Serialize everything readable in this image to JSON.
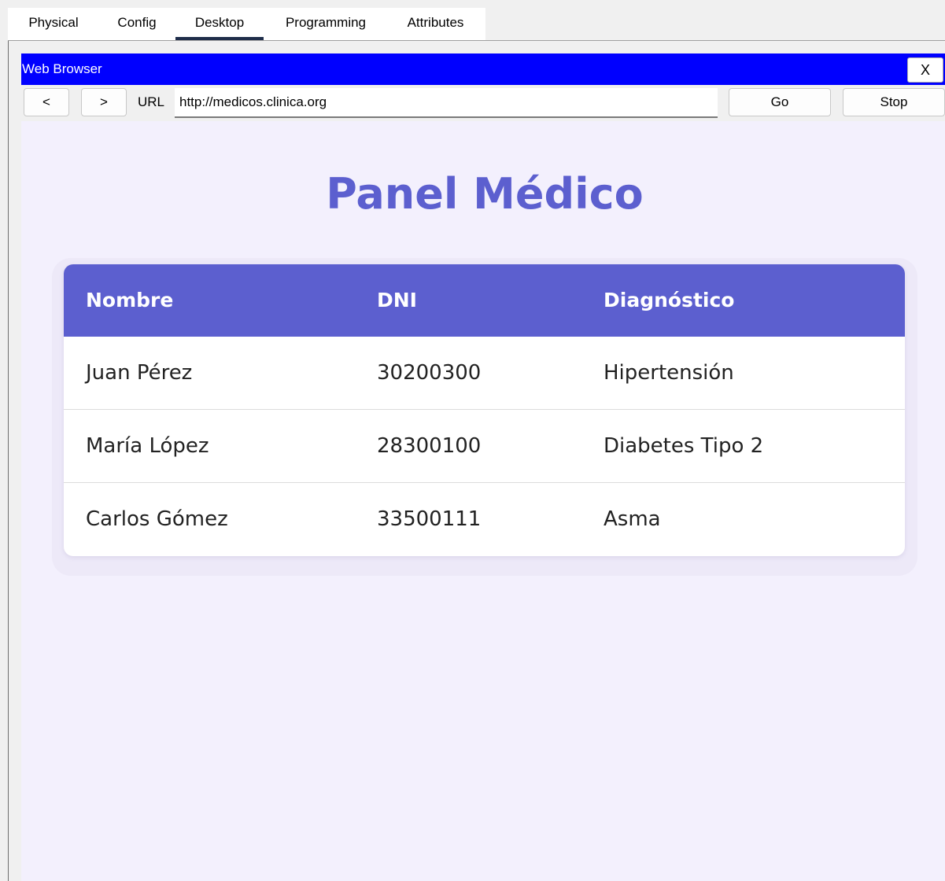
{
  "tabs": [
    {
      "label": "Physical"
    },
    {
      "label": "Config"
    },
    {
      "label": "Desktop"
    },
    {
      "label": "Programming"
    },
    {
      "label": "Attributes"
    }
  ],
  "active_tab": "Desktop",
  "window": {
    "title": "Web Browser",
    "close_label": "X"
  },
  "toolbar": {
    "back_label": "<",
    "forward_label": ">",
    "url_label": "URL",
    "url_value": "http://medicos.clinica.org",
    "go_label": "Go",
    "stop_label": "Stop"
  },
  "page": {
    "title": "Panel Médico",
    "accent_color": "#5c5fcf",
    "background_color": "#f3f0fd",
    "table": {
      "headers": [
        "Nombre",
        "DNI",
        "Diagnóstico"
      ],
      "rows": [
        [
          "Juan Pérez",
          "30200300",
          "Hipertensión"
        ],
        [
          "María López",
          "28300100",
          "Diabetes Tipo 2"
        ],
        [
          "Carlos Gómez",
          "33500111",
          "Asma"
        ]
      ]
    }
  }
}
